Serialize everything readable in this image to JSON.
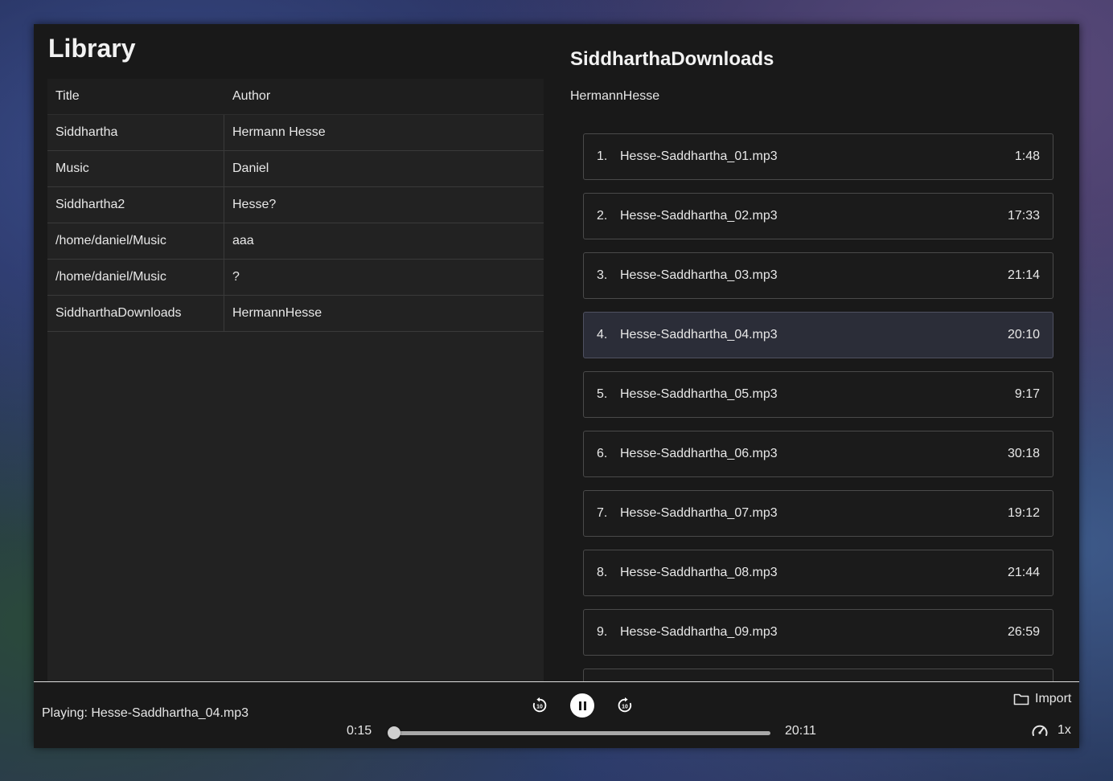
{
  "library": {
    "title": "Library",
    "columns": [
      "Title",
      "Author"
    ],
    "rows": [
      {
        "title": "Siddhartha",
        "author": "Hermann Hesse"
      },
      {
        "title": "Music",
        "author": "Daniel"
      },
      {
        "title": "Siddhartha2",
        "author": "Hesse?"
      },
      {
        "title": "/home/daniel/Music",
        "author": "aaa"
      },
      {
        "title": "/home/daniel/Music",
        "author": "?"
      },
      {
        "title": "SiddharthaDownloads",
        "author": "HermannHesse"
      }
    ]
  },
  "book": {
    "title": "SiddharthaDownloads",
    "author": "HermannHesse",
    "active_track": 4,
    "tracks": [
      {
        "num": "1.",
        "name": "Hesse-Saddhartha_01.mp3",
        "duration": "1:48"
      },
      {
        "num": "2.",
        "name": "Hesse-Saddhartha_02.mp3",
        "duration": "17:33"
      },
      {
        "num": "3.",
        "name": "Hesse-Saddhartha_03.mp3",
        "duration": "21:14"
      },
      {
        "num": "4.",
        "name": "Hesse-Saddhartha_04.mp3",
        "duration": "20:10"
      },
      {
        "num": "5.",
        "name": "Hesse-Saddhartha_05.mp3",
        "duration": "9:17"
      },
      {
        "num": "6.",
        "name": "Hesse-Saddhartha_06.mp3",
        "duration": "30:18"
      },
      {
        "num": "7.",
        "name": "Hesse-Saddhartha_07.mp3",
        "duration": "19:12"
      },
      {
        "num": "8.",
        "name": "Hesse-Saddhartha_08.mp3",
        "duration": "21:44"
      },
      {
        "num": "9.",
        "name": "Hesse-Saddhartha_09.mp3",
        "duration": "26:59"
      },
      {
        "num": "",
        "name": "",
        "duration": ""
      }
    ]
  },
  "player": {
    "now_playing": "Playing: Hesse-Saddhartha_04.mp3",
    "current_time": "0:15",
    "total_time": "20:11",
    "progress_fraction": 0.012,
    "rewind_icon": "replay-10-icon",
    "play_pause_icon": "pause-icon",
    "forward_icon": "forward-10-icon",
    "import_label": "Import",
    "import_icon": "folder-icon",
    "speed_label": "1x",
    "speed_icon": "speedometer-icon"
  },
  "colors": {
    "window_bg": "#191919",
    "table_bg": "#222222",
    "active_track_bg": "#2b2d38",
    "accent_white": "#ffffff"
  }
}
